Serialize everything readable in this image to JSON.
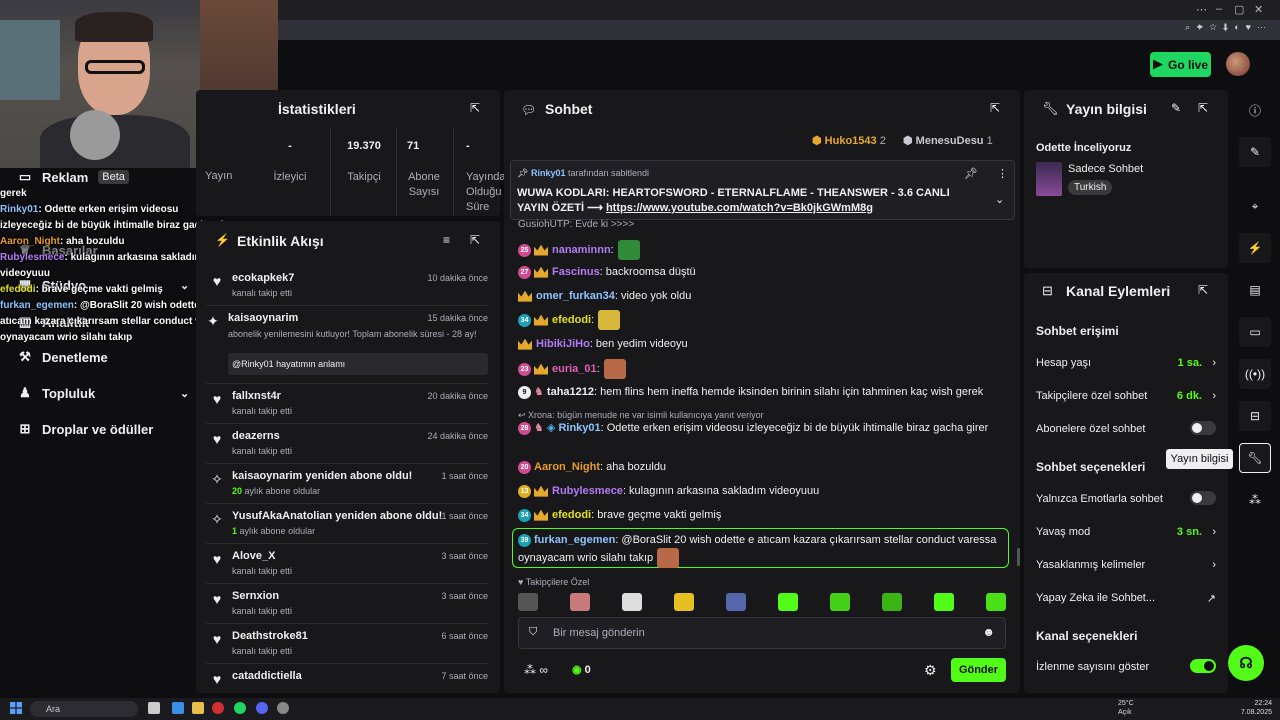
{
  "header": {
    "go_live": "Go live"
  },
  "nav": {
    "reklam": "Reklam",
    "beta": "Beta",
    "basarilar": "Başarılar",
    "studyo": "Stüdyo",
    "analitik": "Analitik",
    "denetleme": "Denetleme",
    "topluluk": "Topluluk",
    "droplar": "Droplar ve ödüller"
  },
  "overlay_chat": [
    {
      "user": "",
      "text": "gerek"
    },
    {
      "user": "Rinky01",
      "text": ": Odette erken erişim videosu"
    },
    {
      "user": "",
      "text": "izleyeceğiz bi de büyük ihtimalle biraz gacha girer"
    },
    {
      "user": "Aaron_Night",
      "text": ": aha bozuldu"
    },
    {
      "user": "Rubylesmece",
      "text": ": kulagının arkasına sakladım"
    },
    {
      "user": "",
      "text": "videoyuuu"
    },
    {
      "user": "efedodi",
      "text": ": brave geçme vakti gelmiş"
    },
    {
      "user": "furkan_egemen",
      "text": ": @BoraSlit 20 wish odette e"
    },
    {
      "user": "",
      "text": "atıcam kazara çıkarırsam stellar conduct varessa"
    },
    {
      "user": "",
      "text": "oynayacam wrio silahı takıp"
    }
  ],
  "stats": {
    "title": "İstatistikleri",
    "yayin": "Yayın",
    "items": [
      {
        "value": "-",
        "label": "İzleyici"
      },
      {
        "value": "19.370",
        "label": "Takipçi"
      },
      {
        "value": "71",
        "label": "Abone Sayısı"
      },
      {
        "value": "-",
        "label": "Yayında Olduğu Süre"
      }
    ]
  },
  "activity": {
    "title": "Etkinlik Akışı",
    "rows": [
      {
        "name": "ecokapkek7",
        "sub": "kanalı takip etti",
        "time": "10 dakika önce",
        "icon": "heart-icon"
      },
      {
        "name": "kaisaoynarim",
        "sub": "abonelik yenilemesini kutluyor! Toplam abonelik süresi - 28 ay!",
        "time": "15 dakika önce",
        "icon": "star-icon",
        "quote": "@Rinky01 hayatımın anlamı"
      },
      {
        "name": "fallxnst4r",
        "sub": "kanalı takip etti",
        "time": "20 dakika önce",
        "icon": "heart-icon"
      },
      {
        "name": "deazerns",
        "sub": "kanalı takip etti",
        "time": "24 dakika önce",
        "icon": "heart-icon"
      },
      {
        "name": "kaisaoynarim yeniden abone oldu!",
        "sub_num": "20",
        "sub": "aylık abone oldular",
        "time": "1 saat önce",
        "icon": "sparkle-icon"
      },
      {
        "name": "YusufAkaAnatolian yeniden abone oldu!",
        "sub_num": "1",
        "sub": "aylık abone oldular",
        "time": "1 saat önce",
        "icon": "sparkle-icon"
      },
      {
        "name": "Alove_X",
        "sub": "kanalı takip etti",
        "time": "3 saat önce",
        "icon": "heart-icon"
      },
      {
        "name": "Sernxion",
        "sub": "kanalı takip etti",
        "time": "3 saat önce",
        "icon": "heart-icon"
      },
      {
        "name": "Deathstroke81",
        "sub": "kanalı takip etti",
        "time": "6 saat önce",
        "icon": "heart-icon"
      },
      {
        "name": "cataddictiella",
        "sub": "",
        "time": "7 saat önce",
        "icon": "heart-icon"
      }
    ]
  },
  "chat": {
    "title": "Sohbet",
    "top_gifters": [
      {
        "name": "Huko1543",
        "count": "2"
      },
      {
        "name": "MenesuDesu",
        "count": "1"
      }
    ],
    "pinned": {
      "by": "Rinky01",
      "by_suffix": "tarafından sabitlendi",
      "text": "WUWA KODLARI: HEARTOFSWORD - ETERNALFLAME - THEANSWER - 3.6 CANLI YAYIN ÖZETİ",
      "arrow": "⟶",
      "link": "https://www.youtube.com/watch?v=Bk0jkGWmM8g"
    },
    "partial_line": "GusiohUTP: Evde ki >>>>",
    "messages": [
      {
        "badge": "25",
        "user": "nanaminnn",
        "text": ":",
        "color": "#b37bf5"
      },
      {
        "badge": "27",
        "user": "Fascinus",
        "text": ": backroomsa düştü",
        "color": "#b37bf5"
      },
      {
        "badge": "",
        "user": "omer_furkan34",
        "text": ": video yok oldu",
        "color": "#8dc3ff"
      },
      {
        "badge": "34",
        "user": "efedodi",
        "text": ":",
        "color": "#e0e020"
      },
      {
        "badge": "",
        "user": "HibikiJiHo",
        "text": ": ben yedim videoyu",
        "color": "#b37bf5"
      },
      {
        "badge": "23",
        "user": "euria_01",
        "text": ":",
        "color": "#e05fb8"
      },
      {
        "badge": "9",
        "user": "taha1212",
        "text": ": hem flins hem ineffa hemde iksinden birinin silahı için tahminen kaç wish gerek",
        "color": "#efeff1"
      }
    ],
    "reply_hint": "Xrona: bügün menude ne var isimli kullanıcıya yanıt veriyor",
    "messages2": [
      {
        "badge": "28",
        "user": "Rinky01",
        "text": ": Odette erken erişim videosu izleyeceğiz bi de büyük ihtimalle biraz gacha girer",
        "color": "#8dc3ff"
      },
      {
        "badge": "20",
        "user": "Aaron_Night",
        "text": ": aha bozuldu",
        "color": "#e49b2c"
      },
      {
        "badge": "13",
        "user": "Rubylesmece",
        "text": ": kulagının arkasına sakladım videoyuuu",
        "color": "#b37bf5"
      },
      {
        "badge": "34",
        "user": "efedodi",
        "text": ": brave geçme vakti gelmiş",
        "color": "#e0e020"
      }
    ],
    "highlight": {
      "badge": "39",
      "user": "furkan_egemen",
      "text": ": @BoraSlit 20 wish odette e atıcam kazara çıkarırsam stellar conduct varessa oynayacam wrio silahı takıp"
    },
    "followers_only": "Takipçilere Özel",
    "input_placeholder": "Bir mesaj gönderin",
    "infinity": "∞",
    "count": "0",
    "send": "Gönder"
  },
  "stream_info": {
    "title": "Yayın bilgisi",
    "stream_title": "Odette İnceliyoruz",
    "category": "Sadece Sohbet",
    "language": "Turkish"
  },
  "channel_actions": {
    "title": "Kanal Eylemleri",
    "chat_access": "Sohbet erişimi",
    "account_age": {
      "label": "Hesap yaşı",
      "value": "1 sa."
    },
    "followers_chat": {
      "label": "Takipçilere özel sohbet",
      "value": "6 dk."
    },
    "subs_chat": {
      "label": "Abonelere özel sohbet"
    },
    "chat_options": "Sohbet seçenekleri",
    "emote_only": {
      "label": "Yalnızca Emotlarla sohbet"
    },
    "slow_mode": {
      "label": "Yavaş mod",
      "value": "3 sn."
    },
    "banned_words": {
      "label": "Yasaklanmış kelimeler"
    },
    "ai_chat": {
      "label": "Yapay Zeka ile Sohbet..."
    },
    "channel_options": "Kanal seçenekleri",
    "show_views": {
      "label": "İzlenme sayısını göster"
    }
  },
  "tooltip": "Yayın bilgisi",
  "taskbar": {
    "search": "Ara",
    "weather_temp": "25°C",
    "weather_desc": "Açık",
    "time": "22:24",
    "date": "7.08.2025"
  },
  "colors": {
    "accent": "#53fc18",
    "bg": "#0e0e10",
    "panel": "#18181b"
  }
}
